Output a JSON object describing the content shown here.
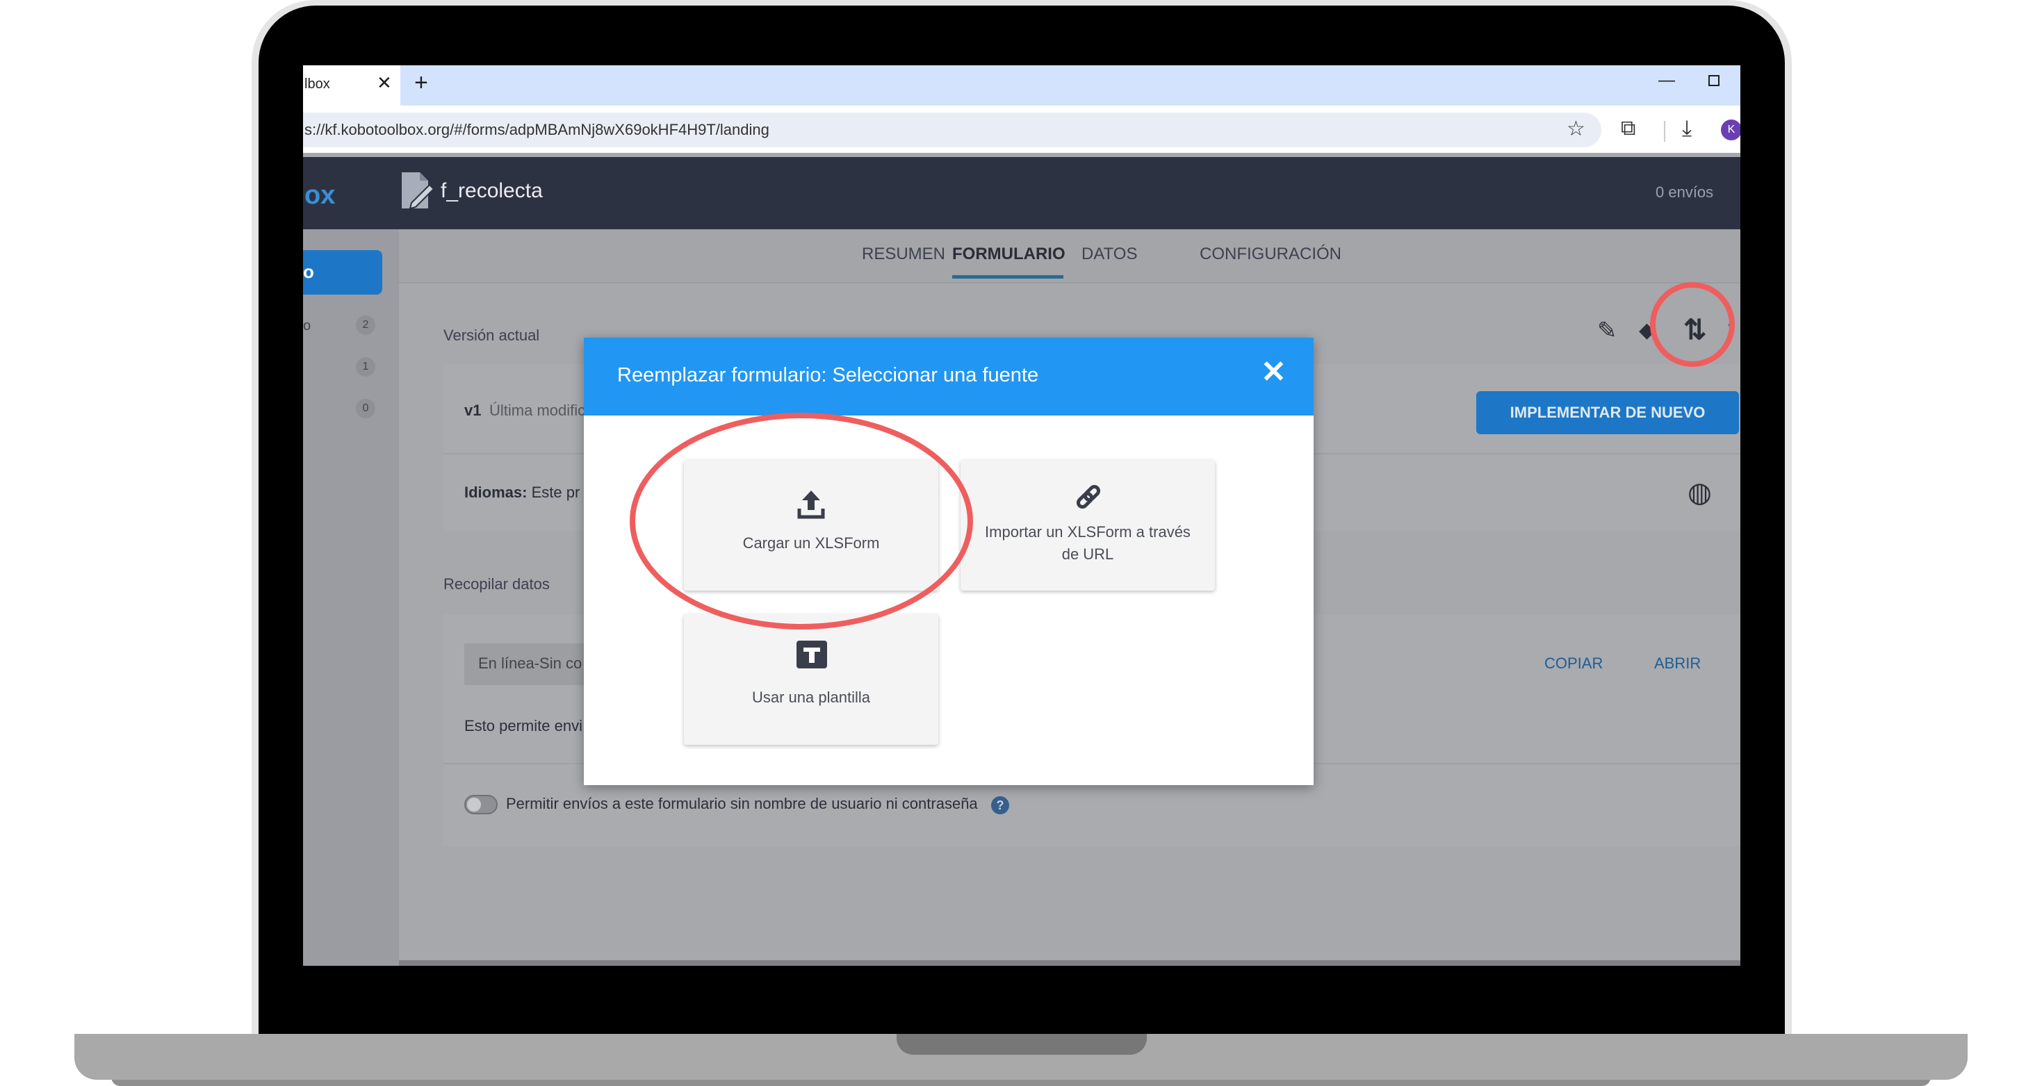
{
  "browser": {
    "tab_title": "lbox",
    "tab_close": "✕",
    "new_tab": "+",
    "minimize": "—",
    "url": "s://kf.kobotoolbox.org/#/forms/adpMBAmNj8wX69okHF4H9T/landing",
    "profile_initial": "K"
  },
  "app": {
    "logo_fragment": "ox",
    "form_title": "f_recolecta",
    "submissions": "0 envíos",
    "sidebar": {
      "button_fragment": "o",
      "items": [
        {
          "label": "o",
          "count": "2"
        },
        {
          "label": "",
          "count": "1"
        },
        {
          "label": "",
          "count": "0"
        }
      ]
    },
    "tabs": [
      "RESUMEN",
      "FORMULARIO",
      "DATOS",
      "CONFIGURACIÓN"
    ],
    "active_tab": "FORMULARIO",
    "current_version_label": "Versión actual",
    "version_badge": "v1",
    "version_text": "Última modific",
    "redeploy_button": "IMPLEMENTAR DE NUEVO",
    "languages_label": "Idiomas:",
    "languages_text": "Este pr",
    "collect_label": "Recopilar datos",
    "link_type": "En línea-Sin co",
    "copy_button": "COPIAR",
    "open_button": "ABRIR",
    "allows_text": "Esto permite envi",
    "anonymous_text": "Permitir envíos a este formulario sin nombre de usuario ni contraseña",
    "help": "?"
  },
  "modal": {
    "title": "Reemplazar formulario: Seleccionar una fuente",
    "close": "✕",
    "options": [
      {
        "label": "Cargar un XLSForm",
        "icon": "upload-icon"
      },
      {
        "label": "Importar un XLSForm a través de URL",
        "icon": "link-icon"
      },
      {
        "label": "Usar una plantilla",
        "icon": "template-icon"
      }
    ]
  },
  "colors": {
    "modal_header": "#2196f3",
    "app_header": "#2d3243",
    "accent": "#1d77c6",
    "highlight_ring": "#ef5e5e"
  }
}
